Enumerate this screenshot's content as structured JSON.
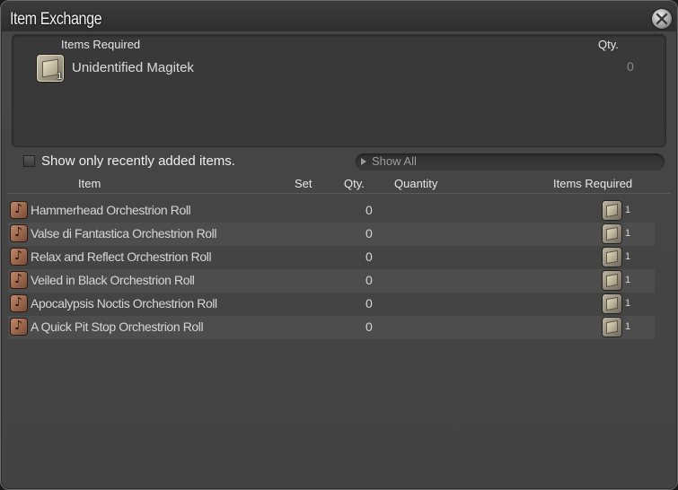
{
  "window": {
    "title": "Item Exchange"
  },
  "required_panel": {
    "header_items": "Items Required",
    "header_qty": "Qty.",
    "item_name": "Unidentified Magitek",
    "item_stack": "1",
    "item_qty": "0"
  },
  "filter": {
    "checkbox_label": "Show only recently added items.",
    "checked": false,
    "show_all_label": "Show All"
  },
  "table": {
    "headers": {
      "item": "Item",
      "set": "Set",
      "qty": "Qty.",
      "quantity": "Quantity",
      "items_required": "Items Required"
    },
    "rows": [
      {
        "name": "Hammerhead Orchestrion Roll",
        "qty": "0",
        "req_count": "1"
      },
      {
        "name": "Valse di Fantastica Orchestrion Roll",
        "qty": "0",
        "req_count": "1"
      },
      {
        "name": "Relax and Reflect Orchestrion Roll",
        "qty": "0",
        "req_count": "1"
      },
      {
        "name": "Veiled in Black Orchestrion Roll",
        "qty": "0",
        "req_count": "1"
      },
      {
        "name": "Apocalypsis Noctis Orchestrion Roll",
        "qty": "0",
        "req_count": "1"
      },
      {
        "name": "A Quick Pit Stop Orchestrion Roll",
        "qty": "0",
        "req_count": "1"
      }
    ]
  },
  "icons": {
    "close": "close-icon",
    "row_item": "music-note-icon",
    "required_item": "magitek-crate-icon"
  },
  "colors": {
    "window_bg": "#434343",
    "row_alt": "#4d4d4d",
    "note_icon": "#c08a6a"
  }
}
